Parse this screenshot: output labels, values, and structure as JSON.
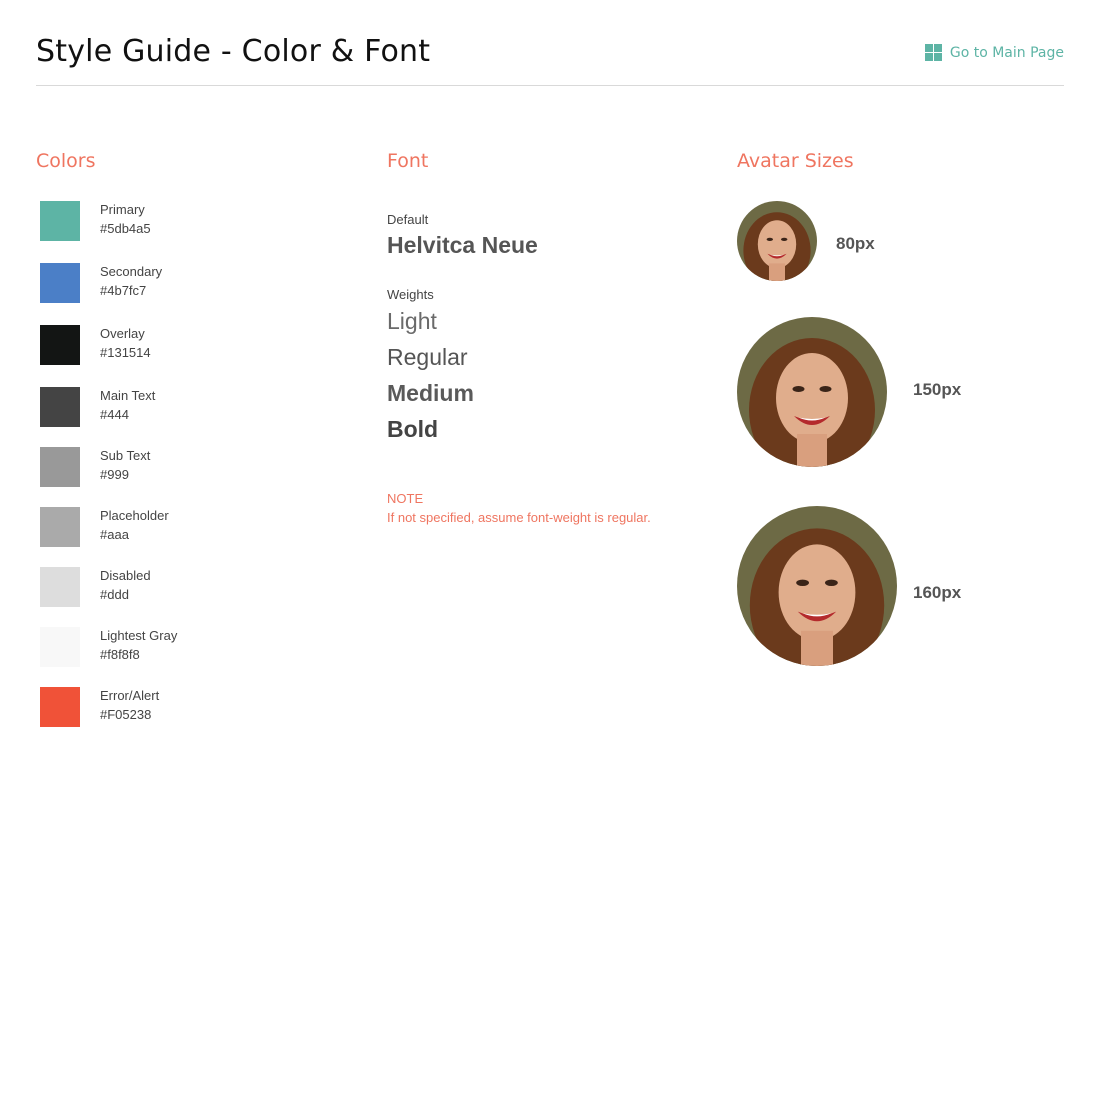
{
  "header": {
    "title": "Style Guide - Color & Font",
    "main_link": "Go to Main Page",
    "main_link_icon": "grid-icon"
  },
  "colors": {
    "title": "Colors",
    "items": [
      {
        "name": "Primary",
        "hex": "#5db4a5",
        "label": "#5db4a5"
      },
      {
        "name": "Secondary",
        "hex": "#4b7fc7",
        "label": "#4b7fc7"
      },
      {
        "name": "Overlay",
        "hex": "#131514",
        "label": "#131514"
      },
      {
        "name": "Main Text",
        "hex": "#444444",
        "label": "#444"
      },
      {
        "name": "Sub Text",
        "hex": "#999999",
        "label": "#999"
      },
      {
        "name": "Placeholder",
        "hex": "#aaaaaa",
        "label": "#aaa"
      },
      {
        "name": "Disabled",
        "hex": "#dddddd",
        "label": "#ddd"
      },
      {
        "name": "Lightest Gray",
        "hex": "#f8f8f8",
        "label": "#f8f8f8"
      },
      {
        "name": "Error/Alert",
        "hex": "#F05238",
        "label": "#F05238"
      }
    ]
  },
  "font": {
    "title": "Font",
    "default_label": "Default",
    "default_value": "Helvitca Neue",
    "weights_label": "Weights",
    "weights": [
      "Light",
      "Regular",
      "Medium",
      "Bold"
    ],
    "note_label": "NOTE",
    "note_text": "If not specified, assume font-weight is regular."
  },
  "avatars": {
    "title": "Avatar Sizes",
    "items": [
      {
        "label": "80px"
      },
      {
        "label": "150px"
      },
      {
        "label": "160px"
      }
    ]
  },
  "accent_color": "#ef7560",
  "link_color": "#5db4a5"
}
